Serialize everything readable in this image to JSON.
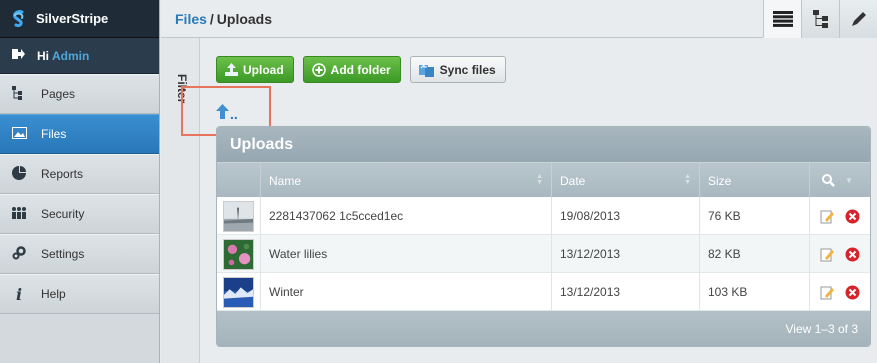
{
  "brand": {
    "name": "SilverStripe"
  },
  "user": {
    "greeting": "Hi",
    "name": "Admin"
  },
  "nav": [
    {
      "label": "Pages",
      "icon": "sitetree-icon"
    },
    {
      "label": "Files",
      "icon": "image-icon",
      "active": true
    },
    {
      "label": "Reports",
      "icon": "pie-chart-icon"
    },
    {
      "label": "Security",
      "icon": "users-icon"
    },
    {
      "label": "Settings",
      "icon": "gears-icon"
    },
    {
      "label": "Help",
      "icon": "info-icon"
    }
  ],
  "breadcrumb": {
    "parent": "Files",
    "separator": "/",
    "current": "Uploads"
  },
  "view_tabs": [
    "list-view-icon",
    "tree-view-icon",
    "edit-icon"
  ],
  "filter": {
    "label": "Filter"
  },
  "toolbar": {
    "upload": "Upload",
    "add_folder": "Add folder",
    "sync_files": "Sync files"
  },
  "up_link": {
    "label": ".."
  },
  "grid": {
    "title": "Uploads",
    "columns": {
      "name": "Name",
      "date": "Date",
      "size": "Size"
    },
    "rows": [
      {
        "name": "2281437062 1c5cced1ec",
        "date": "19/08/2013",
        "size": "76 KB"
      },
      {
        "name": "Water lilies",
        "date": "13/12/2013",
        "size": "82 KB"
      },
      {
        "name": "Winter",
        "date": "13/12/2013",
        "size": "103 KB"
      }
    ],
    "footer": "View 1–3 of 3"
  },
  "colors": {
    "accent": "#2a7ab8",
    "active_nav": "#3387c6",
    "green_button": "#4aa831",
    "highlight": "#e8745e"
  }
}
